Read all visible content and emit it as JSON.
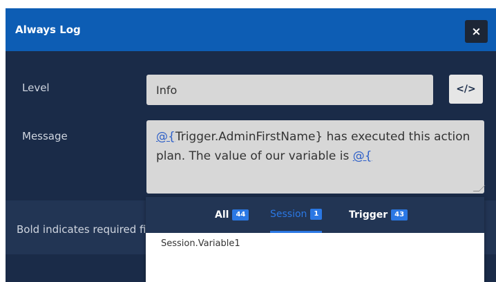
{
  "dialog": {
    "title": "Always Log",
    "close_icon": "×"
  },
  "form": {
    "level_label": "Level",
    "level_value": "Info",
    "code_button_icon": "</>",
    "message_label": "Message",
    "message": {
      "token1": "@{",
      "text1": "Trigger.AdminFirstName} has executed this action plan. The value of our variable is ",
      "token2": "@{"
    }
  },
  "footer": {
    "text": "Bold indicates required fields"
  },
  "autocomplete": {
    "tabs": [
      {
        "label": "All",
        "count": "44"
      },
      {
        "label": "Session",
        "count": "1"
      },
      {
        "label": "Trigger",
        "count": "43"
      }
    ],
    "active_tab": "Session",
    "items": [
      "Session.Variable1"
    ]
  },
  "colors": {
    "title_bar": "#0d5db4",
    "dialog_body": "#1a2b48",
    "accent": "#2b78e4"
  }
}
